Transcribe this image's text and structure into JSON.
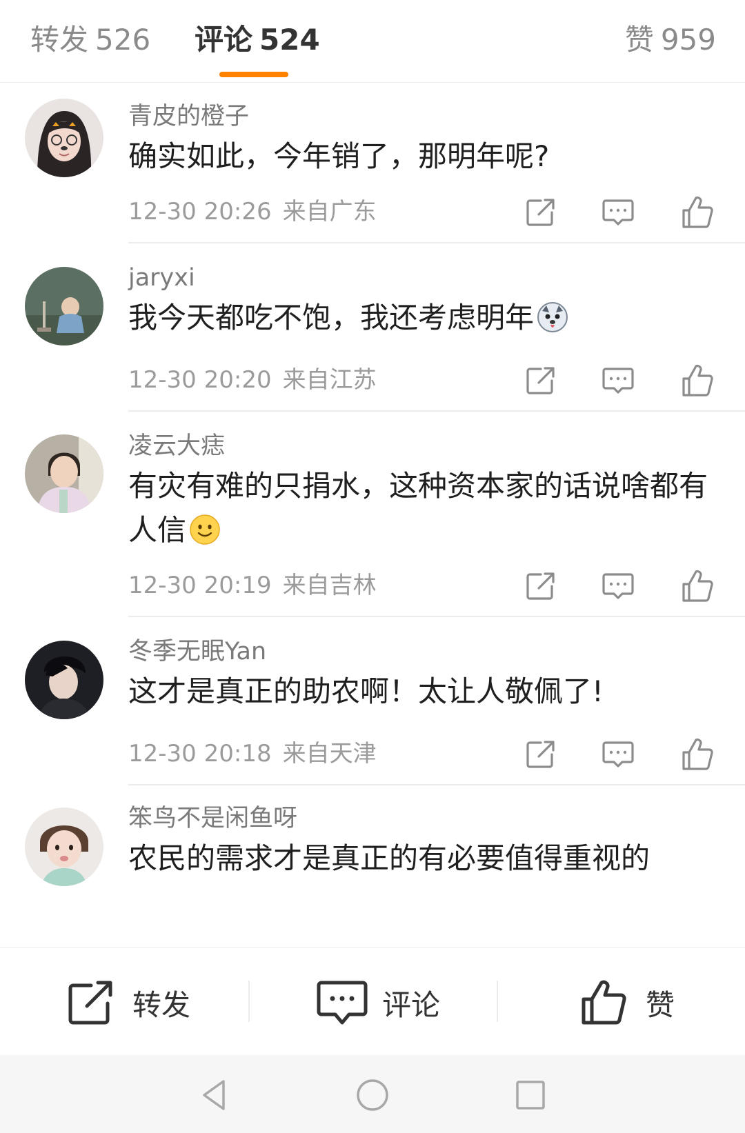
{
  "tabs": {
    "repost": {
      "label": "转发",
      "count": "526"
    },
    "comment": {
      "label": "评论",
      "count": "524"
    },
    "like": {
      "label": "赞",
      "count": "959"
    }
  },
  "comments": [
    {
      "username": "青皮的橙子",
      "text": "确实如此，今年销了，那明年呢?",
      "time": "12-30 20:26",
      "location": "来自广东"
    },
    {
      "username": "jaryxi",
      "text": "我今天都吃不饱，我还考虑明年",
      "time": "12-30 20:20",
      "location": "来自江苏"
    },
    {
      "username": "凌云大痣",
      "text": "有灾有难的只捐水，这种资本家的话说啥都有人信",
      "time": "12-30 20:19",
      "location": "来自吉林"
    },
    {
      "username": "冬季无眠Yan",
      "text": "这才是真正的助农啊！太让人敬佩了!",
      "time": "12-30 20:18",
      "location": "来自天津"
    },
    {
      "username": "笨鸟不是闲鱼呀",
      "text": "农民的需求才是真正的有必要值得重视的",
      "time": "",
      "location": ""
    }
  ],
  "bottom_bar": {
    "repost_label": "转发",
    "comment_label": "评论",
    "like_label": "赞"
  },
  "colors": {
    "accent": "#ff8200",
    "text": "#1f1f1f",
    "meta": "#9b9b9b",
    "username": "#7a7a7a"
  },
  "icons": [
    "share-icon",
    "comment-icon",
    "thumbs-up-icon",
    "dog-emoji-icon",
    "smile-emoji-icon",
    "back-triangle-icon",
    "home-circle-icon",
    "recent-square-icon"
  ]
}
